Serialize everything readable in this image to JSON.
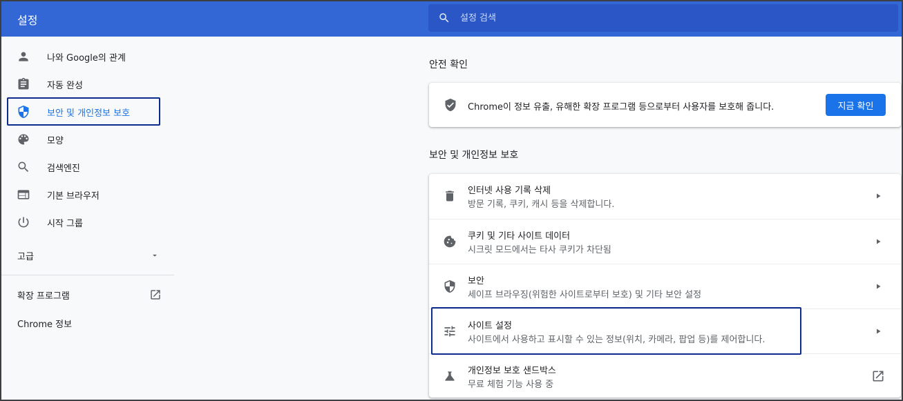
{
  "header": {
    "title": "설정",
    "search_placeholder": "설정 검색"
  },
  "sidebar": {
    "items": [
      {
        "label": "나와 Google의 관계",
        "icon": "person-icon"
      },
      {
        "label": "자동 완성",
        "icon": "clipboard-icon"
      },
      {
        "label": "보안 및 개인정보 보호",
        "icon": "shield-icon",
        "selected": true
      },
      {
        "label": "모양",
        "icon": "palette-icon"
      },
      {
        "label": "검색엔진",
        "icon": "search-icon"
      },
      {
        "label": "기본 브라우저",
        "icon": "browser-window-icon"
      },
      {
        "label": "시작 그룹",
        "icon": "power-icon"
      }
    ],
    "advanced_label": "고급",
    "extensions_label": "확장 프로그램",
    "about_label": "Chrome 정보"
  },
  "safety_check": {
    "section_title": "안전 확인",
    "message": "Chrome이 정보 유출, 유해한 확장 프로그램 등으로부터 사용자를 보호해 줍니다.",
    "button_label": "지금 확인"
  },
  "privacy": {
    "section_title": "보안 및 개인정보 보호",
    "rows": [
      {
        "title": "인터넷 사용 기록 삭제",
        "subtitle": "방문 기록, 쿠키, 캐시 등을 삭제합니다.",
        "icon": "trash-icon"
      },
      {
        "title": "쿠키 및 기타 사이트 데이터",
        "subtitle": "시크릿 모드에서는 타사 쿠키가 차단됨",
        "icon": "cookie-icon"
      },
      {
        "title": "보안",
        "subtitle": "세이프 브라우징(위험한 사이트로부터 보호) 및 기타 보안 설정",
        "icon": "shield-icon"
      },
      {
        "title": "사이트 설정",
        "subtitle": "사이트에서 사용하고 표시할 수 있는 정보(위치, 카메라, 팝업 등)를 제어합니다.",
        "icon": "tune-icon"
      },
      {
        "title": "개인정보 보호 샌드박스",
        "subtitle": "무료 체험 기능 사용 중",
        "icon": "flask-icon"
      }
    ]
  },
  "colors": {
    "header_bg": "#3367d6",
    "accent": "#1a73e8",
    "highlight_border": "#0d2b8c"
  }
}
